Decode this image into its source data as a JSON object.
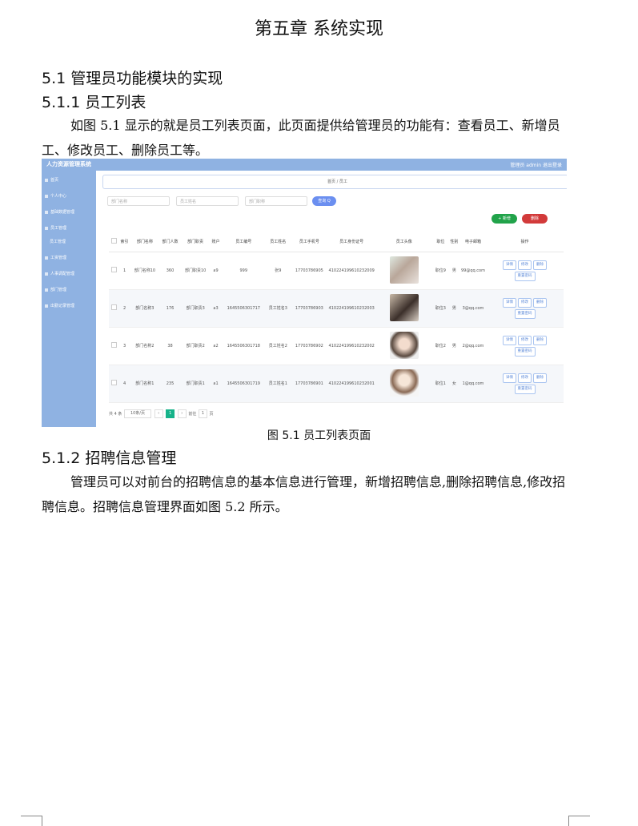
{
  "chapter_title": "第五章  系统实现",
  "section_5_1": "5.1  管理员功能模块的实现",
  "section_5_1_1": "5.1.1  员工列表",
  "para1": "如图 5.1 显示的就是员工列表页面，此页面提供给管理员的功能有：查看员工、新增员工、修改员工、删除员工等。",
  "figure_caption": "图 5.1  员工列表页面",
  "section_5_1_2": "5.1.2  招聘信息管理",
  "para2": "管理员可以对前台的招聘信息的基本信息进行管理，新增招聘信息,删除招聘信息,修改招聘信息。招聘信息管理界面如图 5.2 所示。",
  "screenshot": {
    "app_name": "人力资源管理系统",
    "user_text": "管理员 admin    退出登录",
    "breadcrumb": "首页  /  员工",
    "sidebar": [
      "首页",
      "个人中心",
      "基础数据管理",
      "员工管理",
      "员工管理",
      "工资管理",
      "人事调配管理",
      "部门管理",
      "出勤记录管理"
    ],
    "search_placeholders": [
      "部门名称",
      "员工姓名",
      "部门职称"
    ],
    "search_button": "查询 Q",
    "add_button": "+ 新增",
    "delete_button": "删除",
    "columns": [
      "",
      "索引",
      "部门名称",
      "部门人数",
      "部门职责",
      "账户",
      "员工编号",
      "员工姓名",
      "员工手机号",
      "员工身份证号",
      "员工头像",
      "职位",
      "性别",
      "电子邮箱",
      "操作"
    ],
    "rows": [
      [
        "1",
        "部门名称10",
        "360",
        "部门职责10",
        "a9",
        "999",
        "张9",
        "17703786905",
        "410224199610232009",
        "职位9",
        "男",
        "99@qq.com"
      ],
      [
        "2",
        "部门名称3",
        "176",
        "部门职责3",
        "a3",
        "1645506301717",
        "员工姓名3",
        "17703786903",
        "410224199610232003",
        "职位3",
        "男",
        "3@qq.com"
      ],
      [
        "3",
        "部门名称2",
        "38",
        "部门职责2",
        "a2",
        "1645506301718",
        "员工姓名2",
        "17703786902",
        "410224199610232002",
        "职位2",
        "男",
        "2@qq.com"
      ],
      [
        "4",
        "部门名称1",
        "235",
        "部门职责1",
        "a1",
        "1645506301719",
        "员工姓名1",
        "17703786901",
        "410224199610232001",
        "职位1",
        "女",
        "1@qq.com"
      ]
    ],
    "op_buttons": [
      "详情",
      "修改",
      "删除",
      "重置密码"
    ],
    "pager_total": "共 4 条",
    "pager_size": "10条/页",
    "pager_current": "1",
    "pager_goto": "前往",
    "pager_page": "页"
  }
}
